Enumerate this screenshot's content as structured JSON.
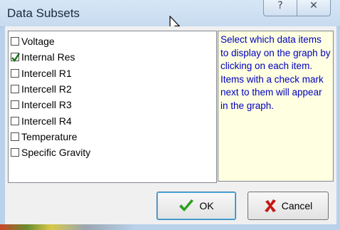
{
  "window": {
    "title": "Data Subsets"
  },
  "titlebar_buttons": {
    "help_glyph": "?",
    "close_glyph": "✕"
  },
  "items": [
    {
      "label": "Voltage",
      "checked": false
    },
    {
      "label": "Internal Res",
      "checked": true
    },
    {
      "label": "Intercell R1",
      "checked": false
    },
    {
      "label": "Intercell R2",
      "checked": false
    },
    {
      "label": "Intercell R3",
      "checked": false
    },
    {
      "label": "Intercell R4",
      "checked": false
    },
    {
      "label": "Temperature",
      "checked": false
    },
    {
      "label": "Specific Gravity",
      "checked": false
    }
  ],
  "help_text": "Select which data items to display on the graph by clicking on each item. Items with a check mark next to them will appear in the graph.",
  "buttons": {
    "ok_label": "OK",
    "ok_icon": "green-checkmark-icon",
    "cancel_label": "Cancel",
    "cancel_icon": "red-x-icon"
  },
  "colors": {
    "help_text": "#0000c0",
    "help_background": "#ffffe1",
    "ok_icon": "#2e9e1f",
    "cancel_icon": "#c41a10"
  }
}
